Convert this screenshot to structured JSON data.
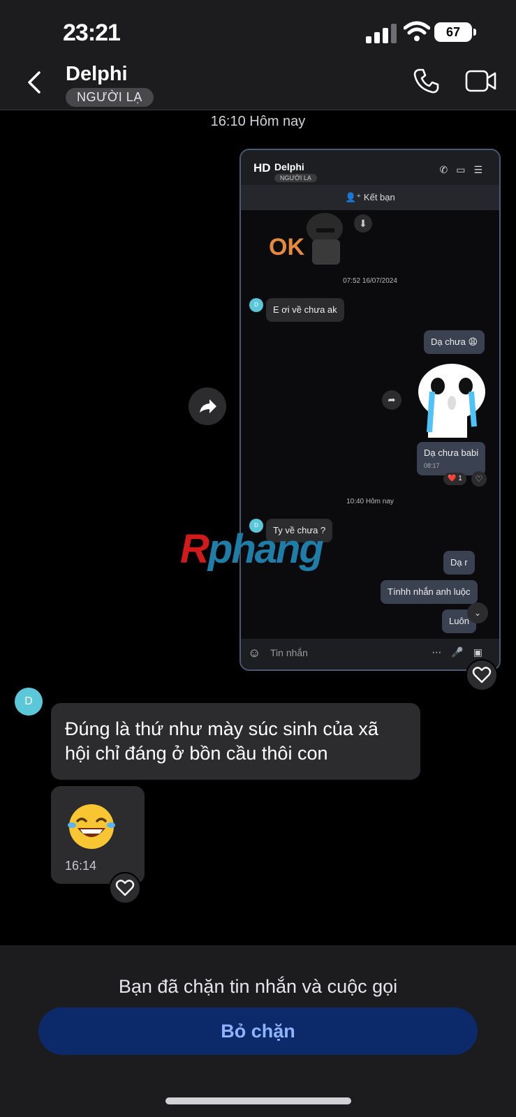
{
  "status_bar": {
    "time": "23:21",
    "battery": "67"
  },
  "header": {
    "contact_name": "Delphi",
    "badge": "NGƯỜI LẠ"
  },
  "chat": {
    "time_separator": "16:10 Hôm nay",
    "shared_screenshot": {
      "initials": "HD",
      "contact_name": "Delphi",
      "badge": "NGƯỜI LẠ",
      "add_friend": "Kết bạn",
      "sticker_text": "OK",
      "time_1": "07:52 16/07/2024",
      "msg_1": "E ơi về chưa ak",
      "reply_1": "Dạ chưa 😩",
      "reply_2": "Dạ chưa babi",
      "reply_2_time": "08:17",
      "reaction": "❤️ 1",
      "time_2": "10:40 Hôm nay",
      "msg_2": "Ty về chưa ?",
      "reply_3": "Dạ r",
      "reply_4": "Tínhh nhắn anh luộc",
      "reply_5": "Luôn",
      "input_placeholder": "Tin nhắn",
      "avatar_letter": "D"
    },
    "watermark": {
      "part1": "R",
      "part2": "phang"
    },
    "avatar_letter": "D",
    "message_text": "Đúng là thứ như mày súc sinh của xã hội chỉ đáng ở bồn cầu thôi con",
    "emoji_time": "16:14"
  },
  "footer": {
    "blocked_notice": "Bạn đã chặn tin nhắn và cuộc gọi",
    "unblock_label": "Bỏ chặn"
  },
  "colors": {
    "accent": "#0c2a6a",
    "accent_text": "#8fb3ff",
    "avatar": "#5ac8d8"
  }
}
